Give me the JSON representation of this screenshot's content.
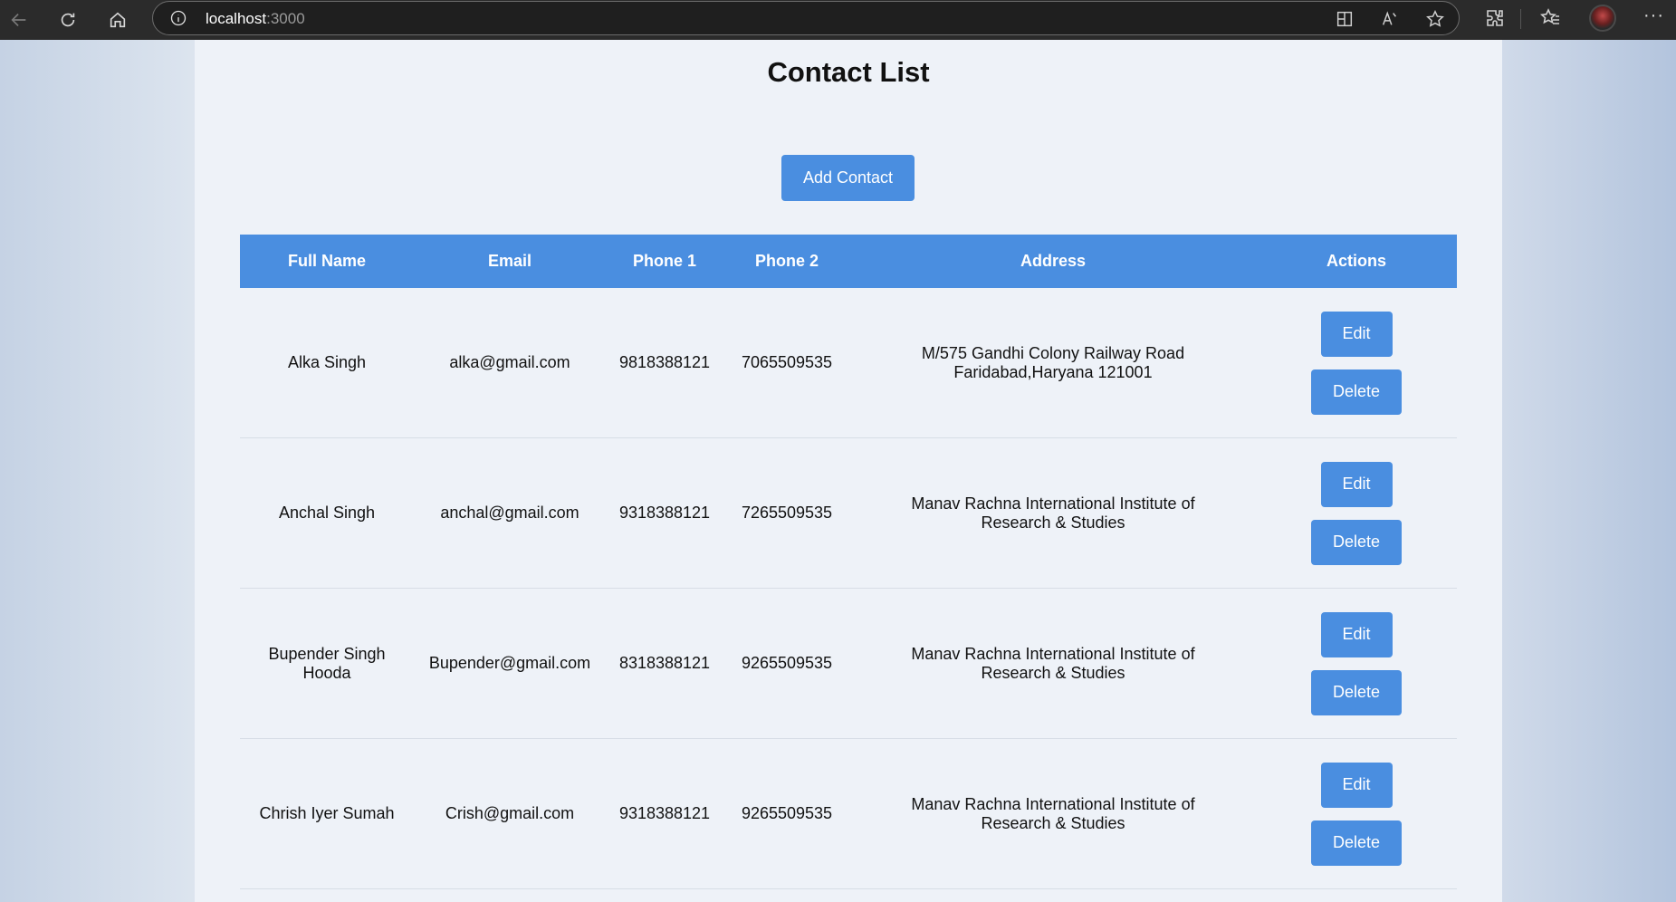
{
  "browser": {
    "url_host": "localhost",
    "url_port": ":3000"
  },
  "page": {
    "title": "Contact List",
    "add_button": "Add Contact"
  },
  "table": {
    "headers": [
      "Full Name",
      "Email",
      "Phone 1",
      "Phone 2",
      "Address",
      "Actions"
    ],
    "rows": [
      {
        "name": "Alka Singh",
        "email": "alka@gmail.com",
        "phone1": "9818388121",
        "phone2": "7065509535",
        "address": "M/575 Gandhi Colony Railway Road Faridabad,Haryana 121001",
        "edit": "Edit",
        "delete": "Delete"
      },
      {
        "name": "Anchal Singh",
        "email": "anchal@gmail.com",
        "phone1": "9318388121",
        "phone2": "7265509535",
        "address": "Manav Rachna International Institute of Research & Studies",
        "edit": "Edit",
        "delete": "Delete"
      },
      {
        "name": "Bupender Singh Hooda",
        "email": "Bupender@gmail.com",
        "phone1": "8318388121",
        "phone2": "9265509535",
        "address": "Manav Rachna International Institute of Research & Studies",
        "edit": "Edit",
        "delete": "Delete"
      },
      {
        "name": "Chrish Iyer Sumah",
        "email": "Crish@gmail.com",
        "phone1": "9318388121",
        "phone2": "9265509535",
        "address": "Manav Rachna International Institute of Research & Studies",
        "edit": "Edit",
        "delete": "Delete"
      }
    ]
  },
  "colors": {
    "accent": "#4a8ee0",
    "chrome": "#2b2b2b"
  },
  "icons": {
    "back": "back-arrow-icon",
    "reload": "reload-icon",
    "home": "home-icon",
    "info": "info-icon",
    "split_screen": "split-screen-icon",
    "read_aloud": "read-aloud-icon",
    "favorite": "star-icon",
    "extensions": "extensions-icon",
    "favorites": "favorites-icon",
    "more": "more-icon"
  }
}
